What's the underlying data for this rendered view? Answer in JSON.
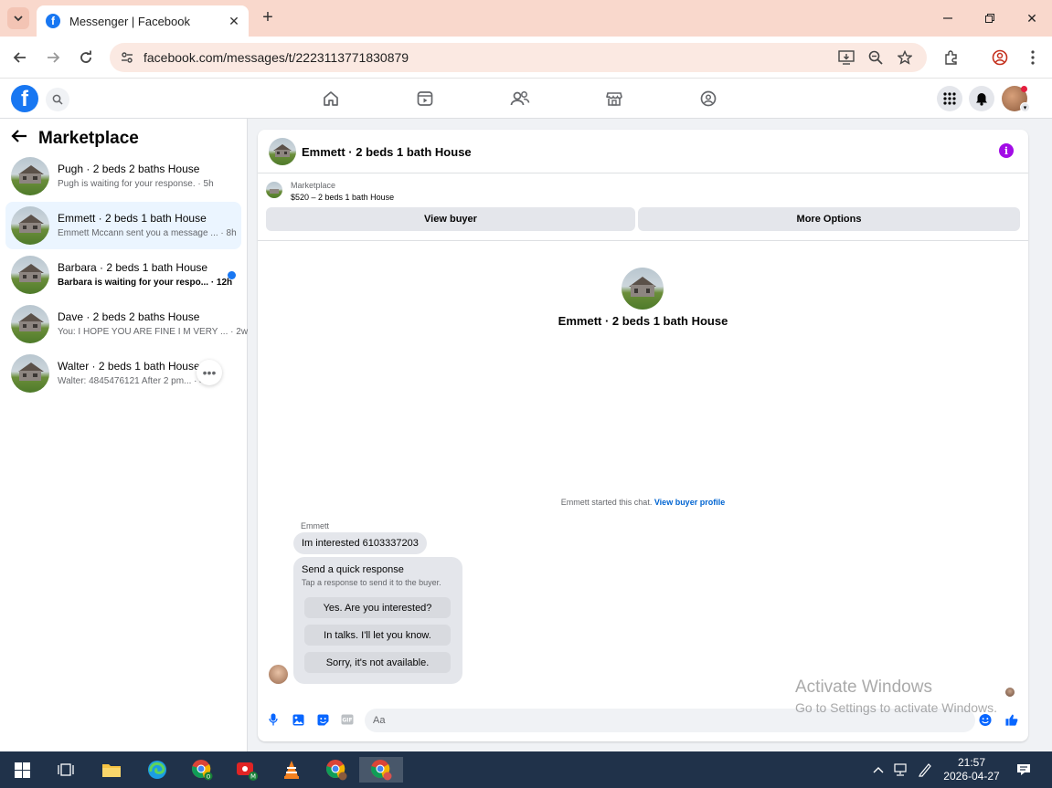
{
  "browser": {
    "tab_title": "Messenger | Facebook",
    "url": "facebook.com/messages/t/2223113771830879"
  },
  "sidebar": {
    "title": "Marketplace",
    "conversations": [
      {
        "title": "Pugh · 2 beds 2 baths House",
        "subtitle": "Pugh is waiting for your response. · 5h",
        "unread": false,
        "active": false
      },
      {
        "title": "Emmett · 2 beds 1 bath House",
        "subtitle": "Emmett Mccann sent you a message ... · 8h",
        "unread": false,
        "active": true
      },
      {
        "title": "Barbara · 2 beds 1 bath House",
        "subtitle": "Barbara is waiting for your respo... · 12h",
        "unread": true,
        "active": false
      },
      {
        "title": "Dave · 2 beds 2 baths House",
        "subtitle": "You: I HOPE YOU ARE FINE I M VERY ... · 2w",
        "unread": false,
        "active": false
      },
      {
        "title": "Walter · 2 beds 1 bath House",
        "subtitle": "Walter: 4845476121 After 2 pm... · 4w",
        "unread": false,
        "active": false
      }
    ]
  },
  "chat": {
    "header_title": "Emmett · 2 beds 1 bath House",
    "listing_label": "Marketplace",
    "listing_price": "$520 – 2 beds 1 bath House",
    "view_buyer_label": "View buyer",
    "more_options_label": "More Options",
    "center_title": "Emmett · 2 beds 1 bath House",
    "started_text": "Emmett started this chat.",
    "view_profile_link": "View buyer profile",
    "sender_name": "Emmett",
    "message": "Im interested 6103337203",
    "quick_response_title": "Send a quick response",
    "quick_response_subtitle": "Tap a response to send it to the buyer.",
    "quick_responses": [
      "Yes. Are you interested?",
      "In talks. I'll let you know.",
      "Sorry, it's not available."
    ],
    "composer_placeholder": "Aa"
  },
  "watermark": {
    "line1": "Activate Windows",
    "line2": "Go to Settings to activate Windows."
  },
  "taskbar": {
    "time": "21:57",
    "date": "2026-04-27"
  },
  "colors": {
    "facebook_blue": "#1877f2",
    "info_purple": "#a20ce6",
    "active_conversation": "#ebf5ff",
    "tab_strip": "#f9d8cc"
  }
}
